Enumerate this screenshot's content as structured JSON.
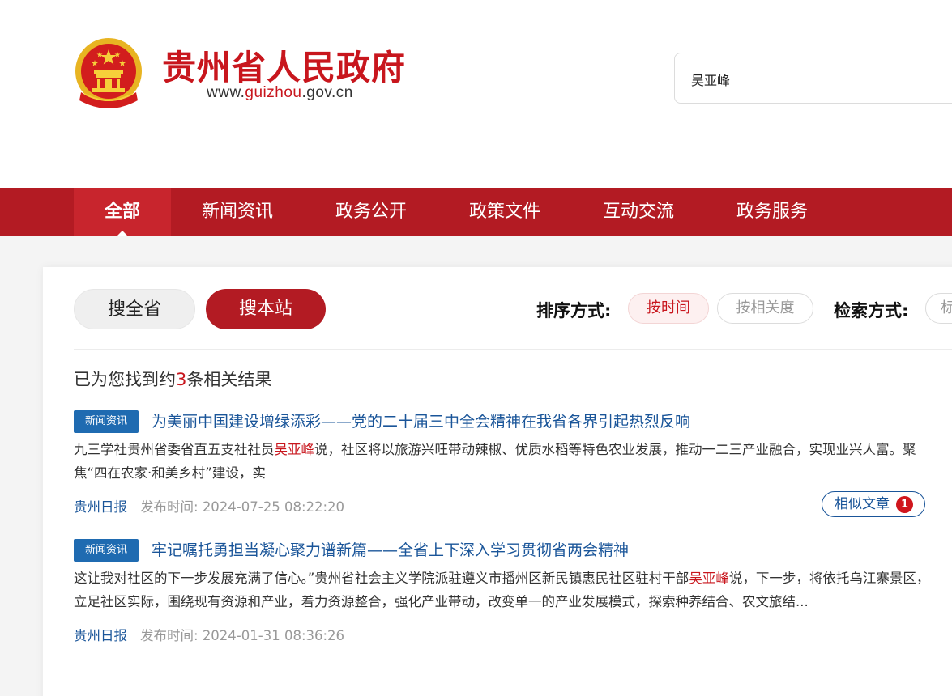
{
  "header": {
    "site_name": "贵州省人民政府",
    "site_url_prefix": "www.",
    "site_url_highlight": "guizhou",
    "site_url_suffix": ".gov.cn"
  },
  "search": {
    "query": "吴亚峰"
  },
  "nav": {
    "items": [
      {
        "label": "全部",
        "active": true
      },
      {
        "label": "新闻资讯"
      },
      {
        "label": "政务公开"
      },
      {
        "label": "政策文件"
      },
      {
        "label": "互动交流"
      },
      {
        "label": "政务服务"
      }
    ]
  },
  "filters": {
    "scope_all": "搜全省",
    "scope_site": "搜本站",
    "sort_label": "排序方式:",
    "sort_time": "按时间",
    "sort_relevance": "按相关度",
    "mode_label": "检索方式:",
    "mode_option": "标"
  },
  "results_summary": {
    "prefix": "已为您找到约",
    "count": "3",
    "suffix": "条相关结果"
  },
  "results": [
    {
      "tag": "新闻资讯",
      "title": "为美丽中国建设增绿添彩——党的二十届三中全会精神在我省各界引起热烈反响",
      "summary_before": "九三学社贵州省委省直五支社社员",
      "keyword": "吴亚峰",
      "summary_after": "说，社区将以旅游兴旺带动辣椒、优质水稻等特色农业发展，推动一二三产业融合，实现业兴人富。聚焦“四在农家·和美乡村”建设，实",
      "source": "贵州日报",
      "time_label": "发布时间:",
      "time": "2024-07-25 08:22:20",
      "similar_label": "相似文章",
      "similar_count": "1"
    },
    {
      "tag": "新闻资讯",
      "title": "牢记嘱托勇担当凝心聚力谱新篇——全省上下深入学习贯彻省两会精神",
      "summary_before": "这让我对社区的下一步发展充满了信心。”贵州省社会主义学院派驻遵义市播州区新民镇惠民社区驻村干部",
      "keyword": "吴亚峰",
      "summary_after": "说，下一步，将依托乌江寨景区，立足社区实际，围绕现有资源和产业，着力资源整合，强化产业带动，改变单一的产业发展模式，探索种养结合、农文旅结...",
      "source": "贵州日报",
      "time_label": "发布时间:",
      "time": "2024-01-31 08:36:26"
    }
  ],
  "colors": {
    "brand_red": "#b31b23",
    "title_red": "#c8161d",
    "link_blue": "#1a5599",
    "tag_blue": "#1f6bb1"
  }
}
